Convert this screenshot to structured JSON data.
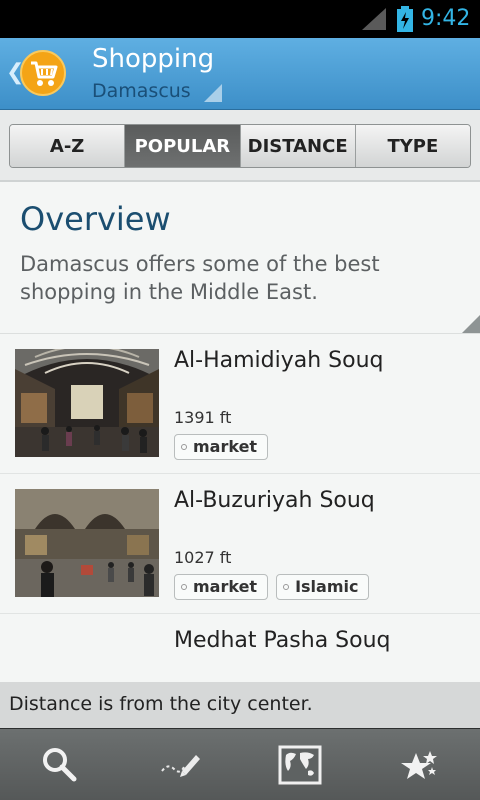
{
  "status_bar": {
    "time": "9:42",
    "icons": [
      "signal-icon",
      "battery-charging-icon"
    ]
  },
  "header": {
    "title": "Shopping",
    "subtitle": "Damascus",
    "icon": "shopping-cart-icon",
    "back": "back-chevron-icon"
  },
  "tabs": [
    {
      "label": "A-Z",
      "active": false
    },
    {
      "label": "POPULAR",
      "active": true
    },
    {
      "label": "DISTANCE",
      "active": false
    },
    {
      "label": "TYPE",
      "active": false
    }
  ],
  "overview": {
    "title": "Overview",
    "text": "Damascus offers some of the best shopping in the Middle East."
  },
  "places": [
    {
      "name": "Al-Hamidiyah Souq",
      "distance": "1391 ft",
      "tags": [
        "market"
      ]
    },
    {
      "name": "Al-Buzuriyah Souq",
      "distance": "1027 ft",
      "tags": [
        "market",
        "Islamic"
      ]
    },
    {
      "name": "Medhat Pasha Souq"
    }
  ],
  "note": "Distance is from the city center.",
  "bottom_bar": [
    "search-icon",
    "notes-pencil-icon",
    "world-map-icon",
    "stars-icon"
  ],
  "colors": {
    "accent": "#33b5e5",
    "header": "#4a9fd6",
    "title_text": "#1b4e70",
    "cart_badge": "#f4a416"
  }
}
